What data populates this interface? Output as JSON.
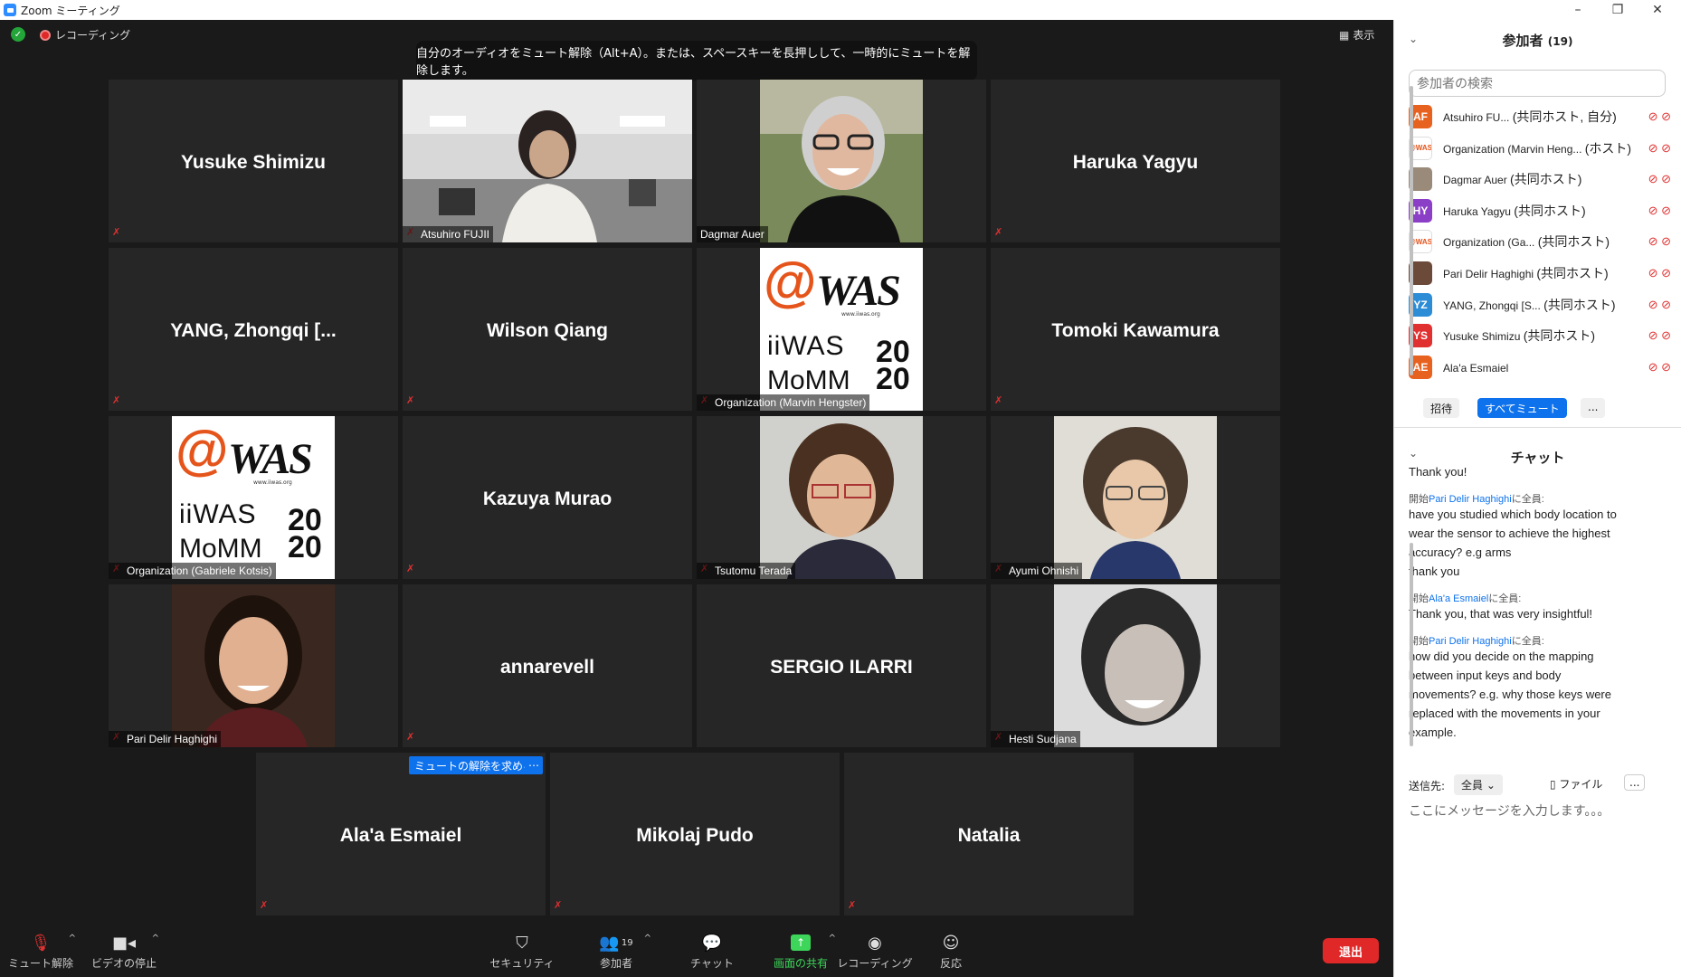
{
  "window": {
    "title": "Zoom ミーティング",
    "minimize": "–",
    "restore": "❐",
    "close": "✕"
  },
  "top": {
    "recording": "レコーディング",
    "view": "表示"
  },
  "tooltip": "自分のオーディオをミュート解除（Alt+A）。または、スペースキーを長押しして、一時的にミュートを解除します。",
  "tiles": [
    {
      "name": "Yusuke Shimizu"
    },
    {
      "label": "Atsuhiro FUJII"
    },
    {
      "label": "Dagmar Auer"
    },
    {
      "name": "Haruka Yagyu"
    },
    {
      "name": "YANG, Zhongqi [..."
    },
    {
      "name": "Wilson Qiang"
    },
    {
      "label": "Organization (Marvin Hengster)"
    },
    {
      "name": "Tomoki Kawamura"
    },
    {
      "label": "Organization (Gabriele Kotsis)"
    },
    {
      "name": "Kazuya Murao"
    },
    {
      "label": "Tsutomu Terada"
    },
    {
      "label": "Ayumi Ohnishi"
    },
    {
      "label": "Pari Delir Haghighi"
    },
    {
      "name": "annarevell"
    },
    {
      "name": "SERGIO ILARRI"
    },
    {
      "label": "Hesti Sudjana"
    },
    {
      "name": "Ala'a Esmaiel"
    },
    {
      "name": "Mikolaj Pudo"
    },
    {
      "name": "Natalia"
    }
  ],
  "logo": {
    "at": "@",
    "was": "WAS",
    "url": "www.iiwas.org",
    "iiwas": "iiWAS",
    "momm": "MoMM",
    "year_top": "20",
    "year_bottom": "20"
  },
  "unmute_request": "ミュートの解除を求める",
  "more": "…",
  "toolbar": {
    "unmute": "ミュート解除",
    "video": "ビデオの停止",
    "security": "セキュリティ",
    "participants": "参加者",
    "participant_count": "19",
    "chat": "チャット",
    "share": "画面の共有",
    "record": "レコーディング",
    "reactions": "反応",
    "end": "退出"
  },
  "panel": {
    "title": "参加者",
    "count": "(19)",
    "search_placeholder": "参加者の検索",
    "participants": [
      {
        "initials": "AF",
        "color": "#e8621f",
        "name": "Atsuhiro FU...",
        "role": "(共同ホスト, 自分)"
      },
      {
        "initials": "@WAS",
        "color": "#ffffff",
        "name": "Organization (Marvin Heng...",
        "role": "(ホスト)"
      },
      {
        "initials": "",
        "color": "#9a8a7a",
        "name": "Dagmar Auer",
        "role": "(共同ホスト)"
      },
      {
        "initials": "HY",
        "color": "#8b3fc7",
        "name": "Haruka Yagyu",
        "role": "(共同ホスト)"
      },
      {
        "initials": "@WAS",
        "color": "#ffffff",
        "name": "Organization (Ga...",
        "role": "(共同ホスト)"
      },
      {
        "initials": "",
        "color": "#6b4a3a",
        "name": "Pari Delir Haghighi",
        "role": "(共同ホスト)"
      },
      {
        "initials": "YZ",
        "color": "#2d8cd6",
        "name": "YANG, Zhongqi [S...",
        "role": "(共同ホスト)"
      },
      {
        "initials": "YS",
        "color": "#e03030",
        "name": "Yusuke Shimizu",
        "role": "(共同ホスト)"
      },
      {
        "initials": "AE",
        "color": "#e8621f",
        "name": "Ala'a Esmaiel",
        "role": ""
      }
    ],
    "invite": "招待",
    "mute_all": "すべてミュート",
    "more": "...",
    "chat_title": "チャット",
    "chat": [
      {
        "type": "text",
        "text": "Thank you!"
      },
      {
        "type": "from",
        "prefix": "開始",
        "name": "Pari Delir Haghighi",
        "suffix": "に全員:"
      },
      {
        "type": "text",
        "text": "have you studied which body location to"
      },
      {
        "type": "text",
        "text": "wear the sensor to achieve the highest"
      },
      {
        "type": "text",
        "text": "accuracy? e.g arms"
      },
      {
        "type": "text",
        "text": "thank you"
      },
      {
        "type": "from",
        "prefix": "開始",
        "name": "Ala'a Esmaiel",
        "suffix": "に全員:"
      },
      {
        "type": "text",
        "text": "Thank you, that was very insightful!"
      },
      {
        "type": "from",
        "prefix": "開始",
        "name": "Pari Delir Haghighi",
        "suffix": "に全員:"
      },
      {
        "type": "text",
        "text": "how did you decide on the mapping"
      },
      {
        "type": "text",
        "text": "between input keys and body"
      },
      {
        "type": "text",
        "text": "movements? e.g. why those keys were"
      },
      {
        "type": "text",
        "text": "replaced with the movements in your"
      },
      {
        "type": "text",
        "text": "example."
      }
    ],
    "send_to_label": "送信先:",
    "send_to_value": "全員",
    "file": "ファイル",
    "input_placeholder": "ここにメッセージを入力します。。。"
  }
}
